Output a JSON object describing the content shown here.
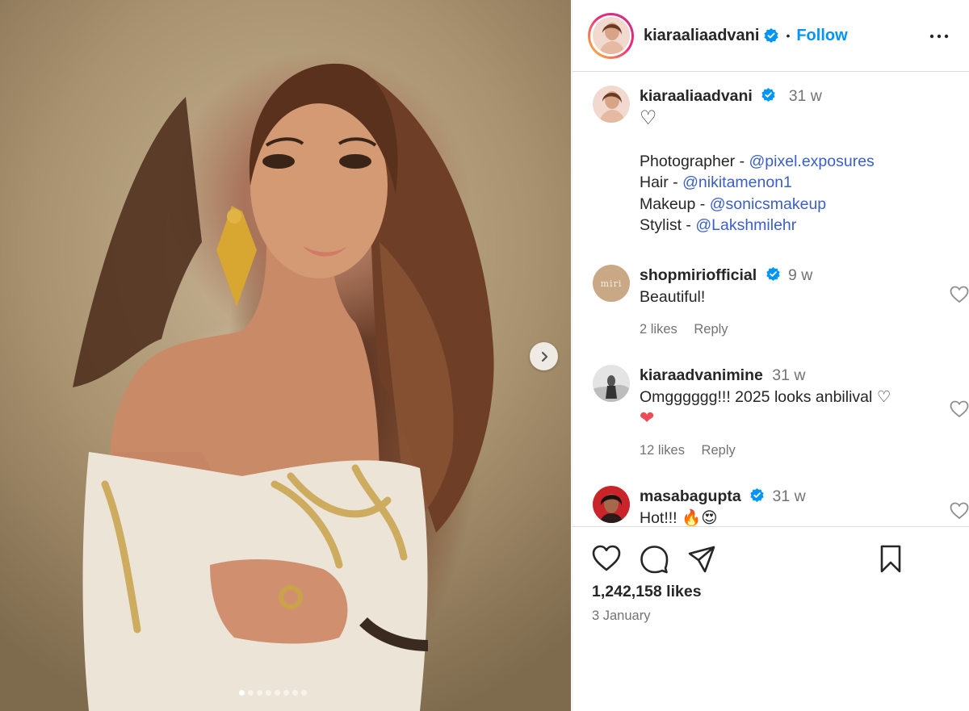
{
  "post": {
    "username": "kiaraaliaadvani",
    "follow_label": "Follow",
    "separator": "•",
    "caption": {
      "time": "31 w",
      "heart": "♡",
      "lines": [
        {
          "label": "Photographer - ",
          "mention": "@pixel.exposures"
        },
        {
          "label": "Hair - ",
          "mention": "@nikitamenon1"
        },
        {
          "label": "Makeup - ",
          "mention": "@sonicsmakeup"
        },
        {
          "label": "Stylist - ",
          "mention": "@Lakshmilehr"
        }
      ]
    },
    "comments": [
      {
        "username": "shopmiriofficial",
        "verified": true,
        "time": "9 w",
        "text": "Beautiful!",
        "likes": "2 likes",
        "reply": "Reply",
        "avatar_text": "miri"
      },
      {
        "username": "kiaraadvanimine",
        "verified": false,
        "time": "31 w",
        "text": "Omgggggg!!! 2025 looks anbilival ♡",
        "text2": "❤",
        "likes": "12 likes",
        "reply": "Reply"
      },
      {
        "username": "masabagupta",
        "verified": true,
        "time": "31 w",
        "text": "Hot!!! 🔥😍"
      }
    ],
    "likes_count": "1,242,158 likes",
    "date": "3 January"
  },
  "carousel": {
    "slide_count": 8,
    "active_index": 0
  },
  "colors": {
    "accent": "#0095f6",
    "verified": "#0095f6",
    "mention": "#3a5fc8",
    "muted": "#737373",
    "heart_red": "#ed4956"
  },
  "icons": [
    "more-icon",
    "verified-icon",
    "heart-icon",
    "comment-icon",
    "share-icon",
    "bookmark-icon",
    "chevron-right-icon"
  ]
}
